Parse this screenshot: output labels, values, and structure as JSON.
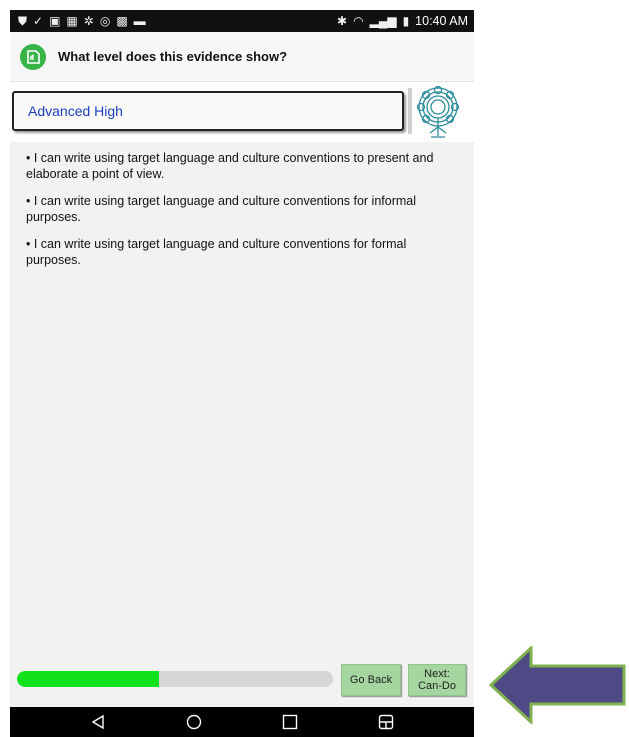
{
  "status_bar": {
    "time": "10:40 AM",
    "left_icons": [
      "shield-icon",
      "check-icon",
      "image-icon",
      "photo-icon",
      "android-icon",
      "wifi-icon",
      "photo-icon",
      "message-icon"
    ],
    "right_icons": [
      "bluetooth-icon",
      "wifi-icon",
      "signal-icon",
      "battery-icon"
    ]
  },
  "header": {
    "title": "What level does this evidence show?"
  },
  "level": {
    "value": "Advanced High"
  },
  "statements": [
    "• I can write using target language and culture conventions to present and elaborate a point of view.",
    "• I can write using target language and culture conventions for informal purposes.",
    "• I can write using target language and culture conventions for formal purposes."
  ],
  "footer": {
    "progress_fraction": 0.45,
    "back_label": "Go Back",
    "next_label_line1": "Next:",
    "next_label_line2": "Can-Do"
  },
  "colors": {
    "accent_green": "#11e21b",
    "button_green": "#a6d6a0",
    "level_text": "#1b3fbf",
    "arrow_fill": "#4e4a86",
    "arrow_border": "#7fb24f"
  }
}
